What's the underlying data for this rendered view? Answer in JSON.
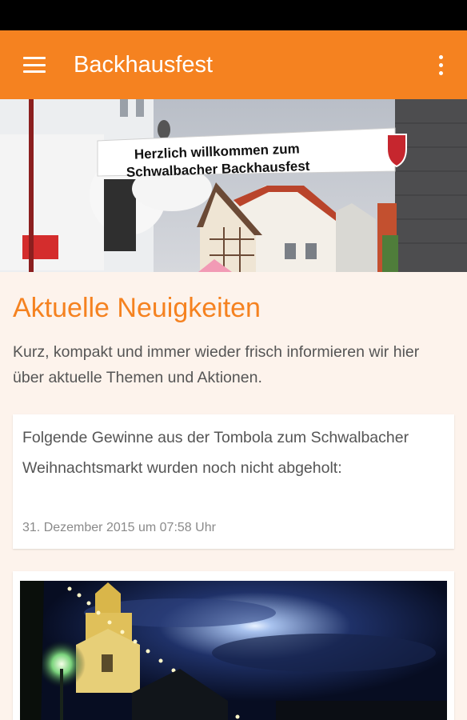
{
  "app_bar": {
    "title": "Backhausfest",
    "menu_icon": "hamburger-menu-icon",
    "overflow_icon": "more-vert-icon",
    "color": "#f58220"
  },
  "hero": {
    "banner_line1": "Herzlich willkommen zum",
    "banner_line2": "Schwalbacher Backhausfest"
  },
  "main": {
    "title": "Aktuelle Neuigkeiten",
    "intro": "Kurz, kompakt und immer wieder frisch informieren wir hier über aktuelle Themen und Aktionen.",
    "news": [
      {
        "text": "Folgende Gewinne aus der Tombola zum Schwalbacher Weihnachtsmarkt wurden noch nicht abgeholt:",
        "date": "31. Dezember 2015 um 07:58 Uhr"
      }
    ]
  }
}
